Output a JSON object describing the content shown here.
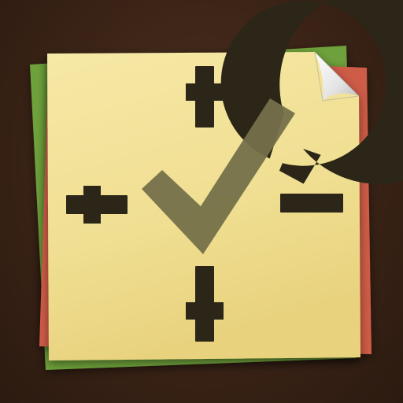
{
  "icon": {
    "name": "crosshair-checkmark-notes-app-icon",
    "colors": {
      "background": "#3a2316",
      "green_note": "#6fa23a",
      "red_note": "#cf5a48",
      "yellow_note": "#f3e39a",
      "ink": "#2b2618",
      "check": "#77704a"
    }
  }
}
